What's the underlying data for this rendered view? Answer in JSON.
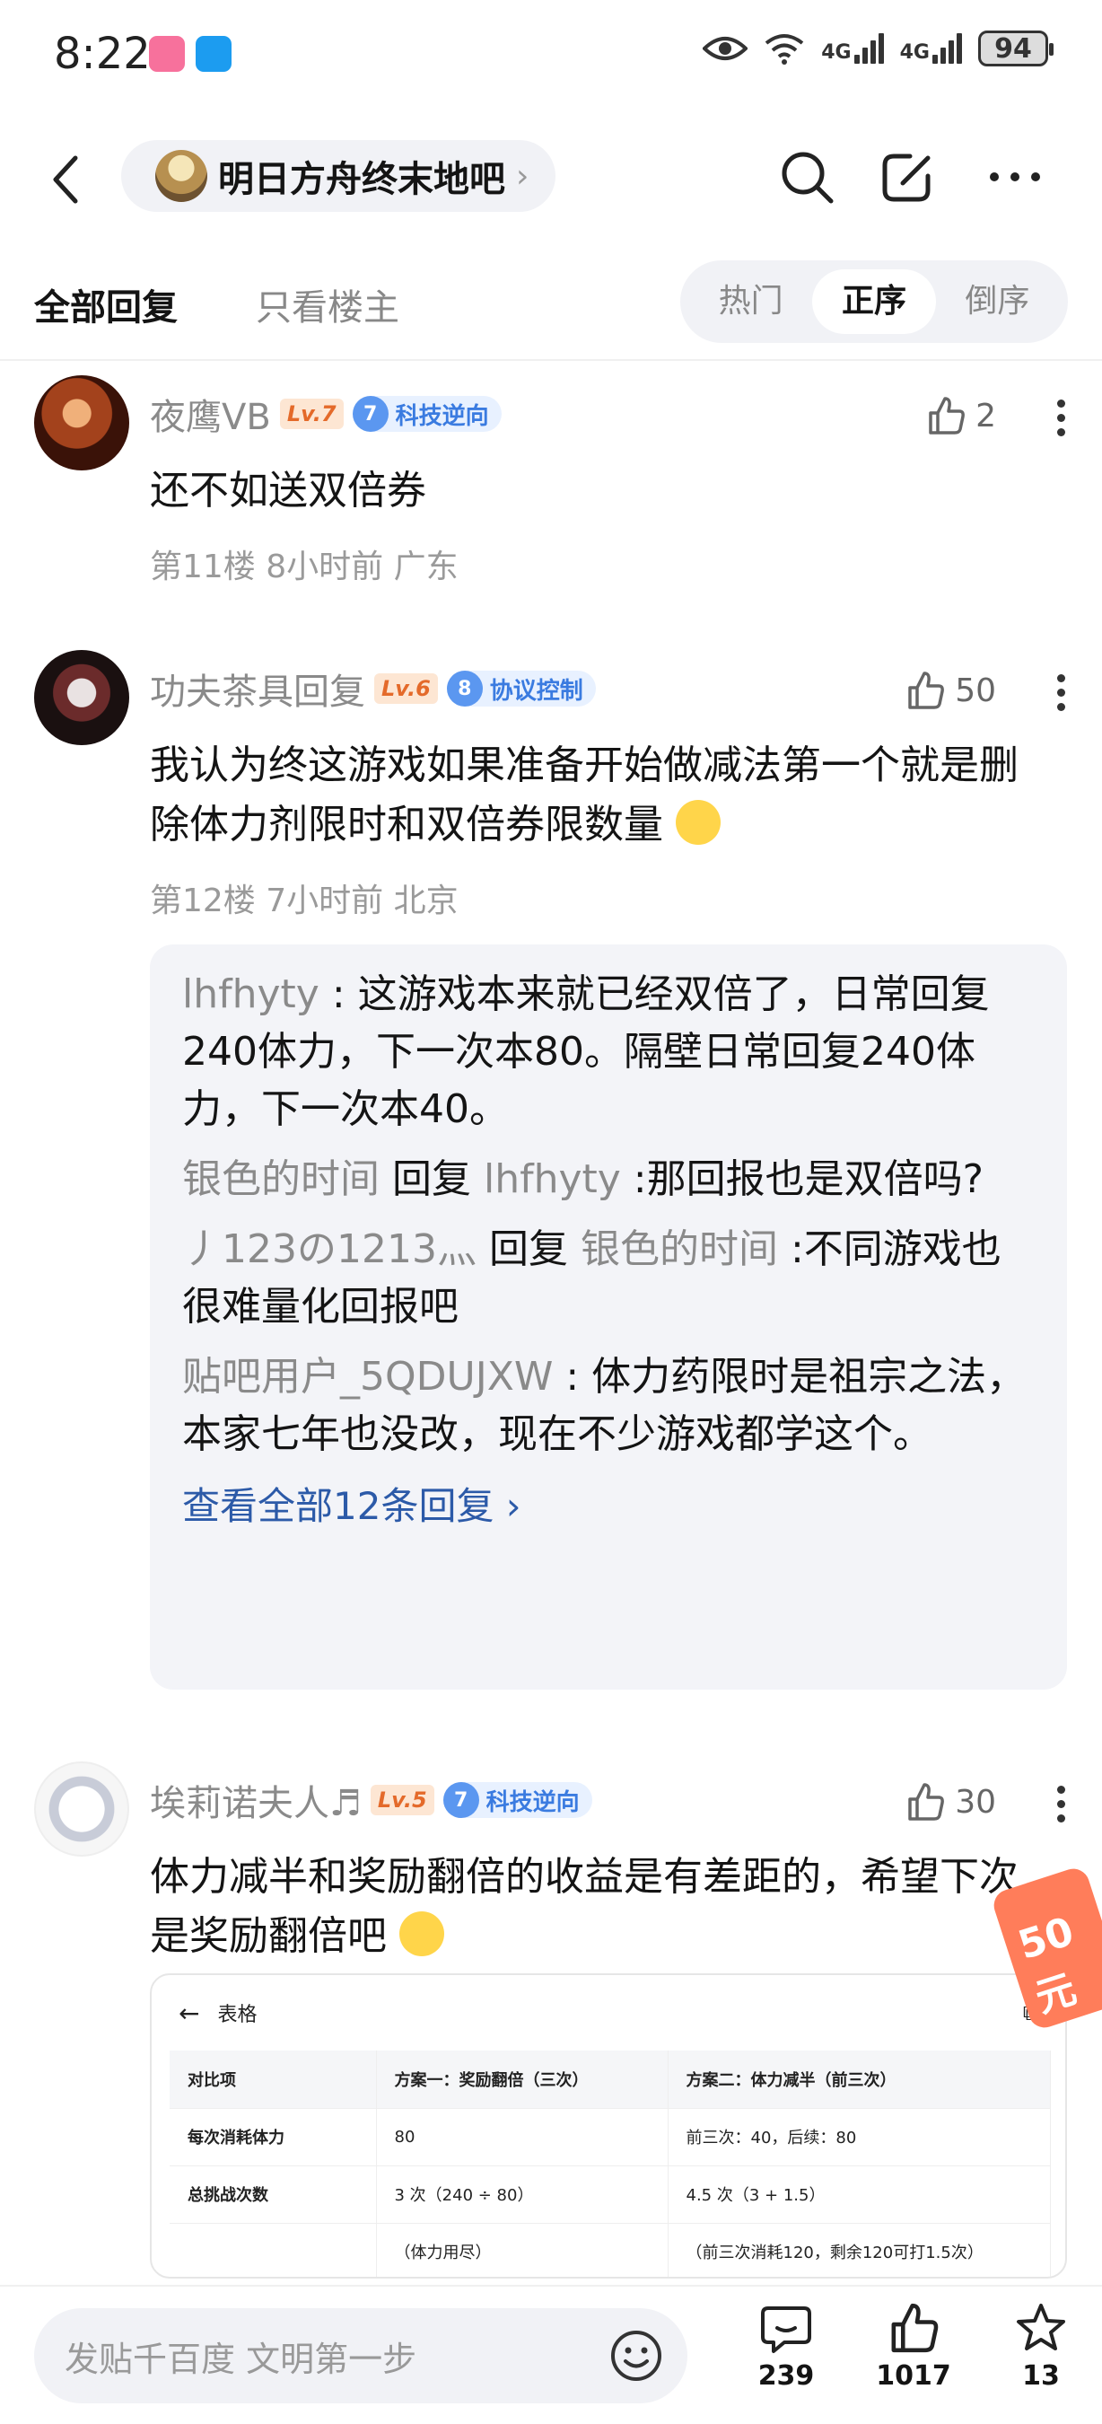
{
  "status_bar": {
    "time": "8:22",
    "battery": "94",
    "network_1": "4G",
    "network_2": "4G"
  },
  "nav": {
    "forum_name": "明日方舟终末地吧"
  },
  "tabs": {
    "all_replies": "全部回复",
    "op_only": "只看楼主",
    "sort_options": [
      "热门",
      "正序",
      "倒序"
    ],
    "sort_active": "正序"
  },
  "posts": [
    {
      "username": "夜鹰VB",
      "level": "Lv.7",
      "tag_num": "7",
      "tag_label": "科技逆向",
      "likes": "2",
      "content": "还不如送双倍券",
      "meta": "第11楼 8小时前 广东"
    },
    {
      "username": "功夫茶具回复",
      "level": "Lv.6",
      "tag_num": "8",
      "tag_label": "协议控制",
      "likes": "50",
      "content": "我认为终这游戏如果准备开始做减法第一个就是删除体力剂限时和双倍券限数量",
      "meta": "第12楼 7小时前 北京",
      "replies": [
        {
          "who": "lhfhyty",
          "text": " : 这游戏本来就已经双倍了，日常回复240体力，下一次本80。隔壁日常回复240体力，下一次本40。"
        },
        {
          "who": "银色的时间",
          "mid": " 回复 ",
          "to": "lhfhyty",
          "text": "  :那回报也是双倍吗?"
        },
        {
          "who": "丿123の1213灬",
          "mid": " 回复 ",
          "to": "银色的时间",
          "text": "  :不同游戏也很难量化回报吧"
        },
        {
          "who": "贴吧用户_5QDUJXW",
          "text": " : 体力药限时是祖宗之法，本家七年也没改，现在不少游戏都学这个。"
        }
      ],
      "view_all": "查看全部12条回复 ›"
    },
    {
      "username": "埃莉诺夫人♬",
      "level": "Lv.5",
      "tag_num": "7",
      "tag_label": "科技逆向",
      "likes": "30",
      "content": "体力减半和奖励翻倍的收益是有差距的，希望下次是奖励翻倍吧",
      "table": {
        "title": "表格",
        "rows": [
          [
            "对比项",
            "方案一：奖励翻倍（三次）",
            "方案二：体力减半（前三次）"
          ],
          [
            "每次消耗体力",
            "80",
            "前三次：40，后续：80"
          ],
          [
            "总挑战次数",
            "3 次（240 ÷ 80）",
            "4.5 次（3 + 1.5）"
          ],
          [
            "",
            "（体力用尽）",
            "（前三次消耗120，剩余120可打1.5次）"
          ]
        ]
      }
    }
  ],
  "promo": {
    "text": "50元"
  },
  "bottom_bar": {
    "input_placeholder": "发贴千百度 文明第一步",
    "comments": "239",
    "likes": "1017",
    "favorites": "13"
  }
}
